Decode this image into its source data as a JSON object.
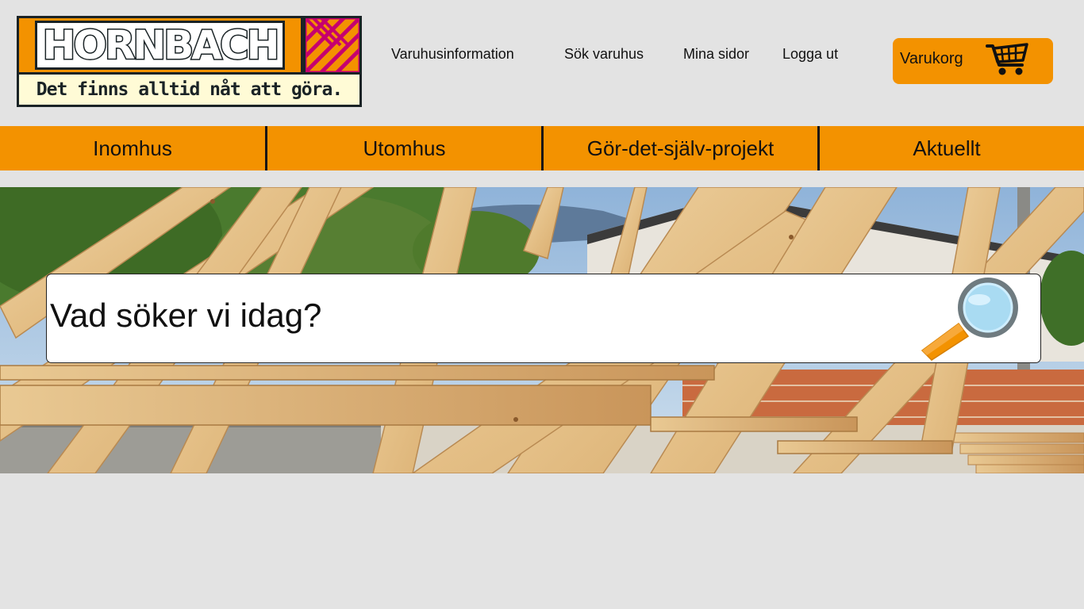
{
  "header": {
    "logo_wordmark": "HORNBACH",
    "logo_slogan": "Det finns alltid nåt att göra.",
    "links": {
      "store_info": "Varuhusinformation",
      "find_store": "Sök varuhus",
      "my_pages": "Mina sidor",
      "logout": "Logga ut"
    },
    "cart_label": "Varukorg",
    "cart_icon": "shopping-cart-icon"
  },
  "nav": {
    "items": [
      "Inomhus",
      "Utomhus",
      "Gör-det-själv-projekt",
      "Aktuellt"
    ]
  },
  "search": {
    "placeholder": "Vad söker vi idag?",
    "icon": "magnifying-glass-icon"
  },
  "colors": {
    "brand_orange": "#f39200",
    "brand_magenta": "#c6006f",
    "page_bg": "#e3e3e3"
  }
}
